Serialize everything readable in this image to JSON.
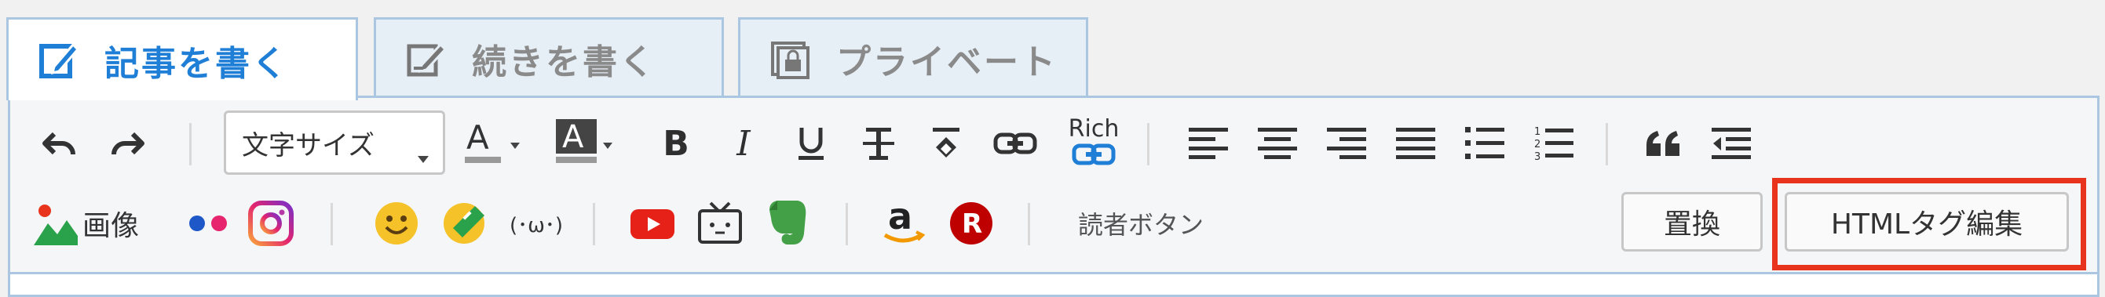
{
  "tabs": [
    {
      "label": "記事を書く",
      "icon": "edit-icon",
      "active": true
    },
    {
      "label": "続きを書く",
      "icon": "edit-more-icon",
      "active": false
    },
    {
      "label": "プライベート",
      "icon": "private-icon",
      "active": false
    }
  ],
  "toolbar": {
    "font_size_label": "文字サイズ",
    "rich_label": "Rich",
    "image_label": "画像",
    "reader_button_label": "読者ボタン",
    "replace_label": "置換",
    "html_edit_label": "HTMLタグ編集"
  },
  "colors": {
    "accent": "#1f7ed6",
    "tab_border": "#aac6e1",
    "highlight": "#e8341c"
  }
}
